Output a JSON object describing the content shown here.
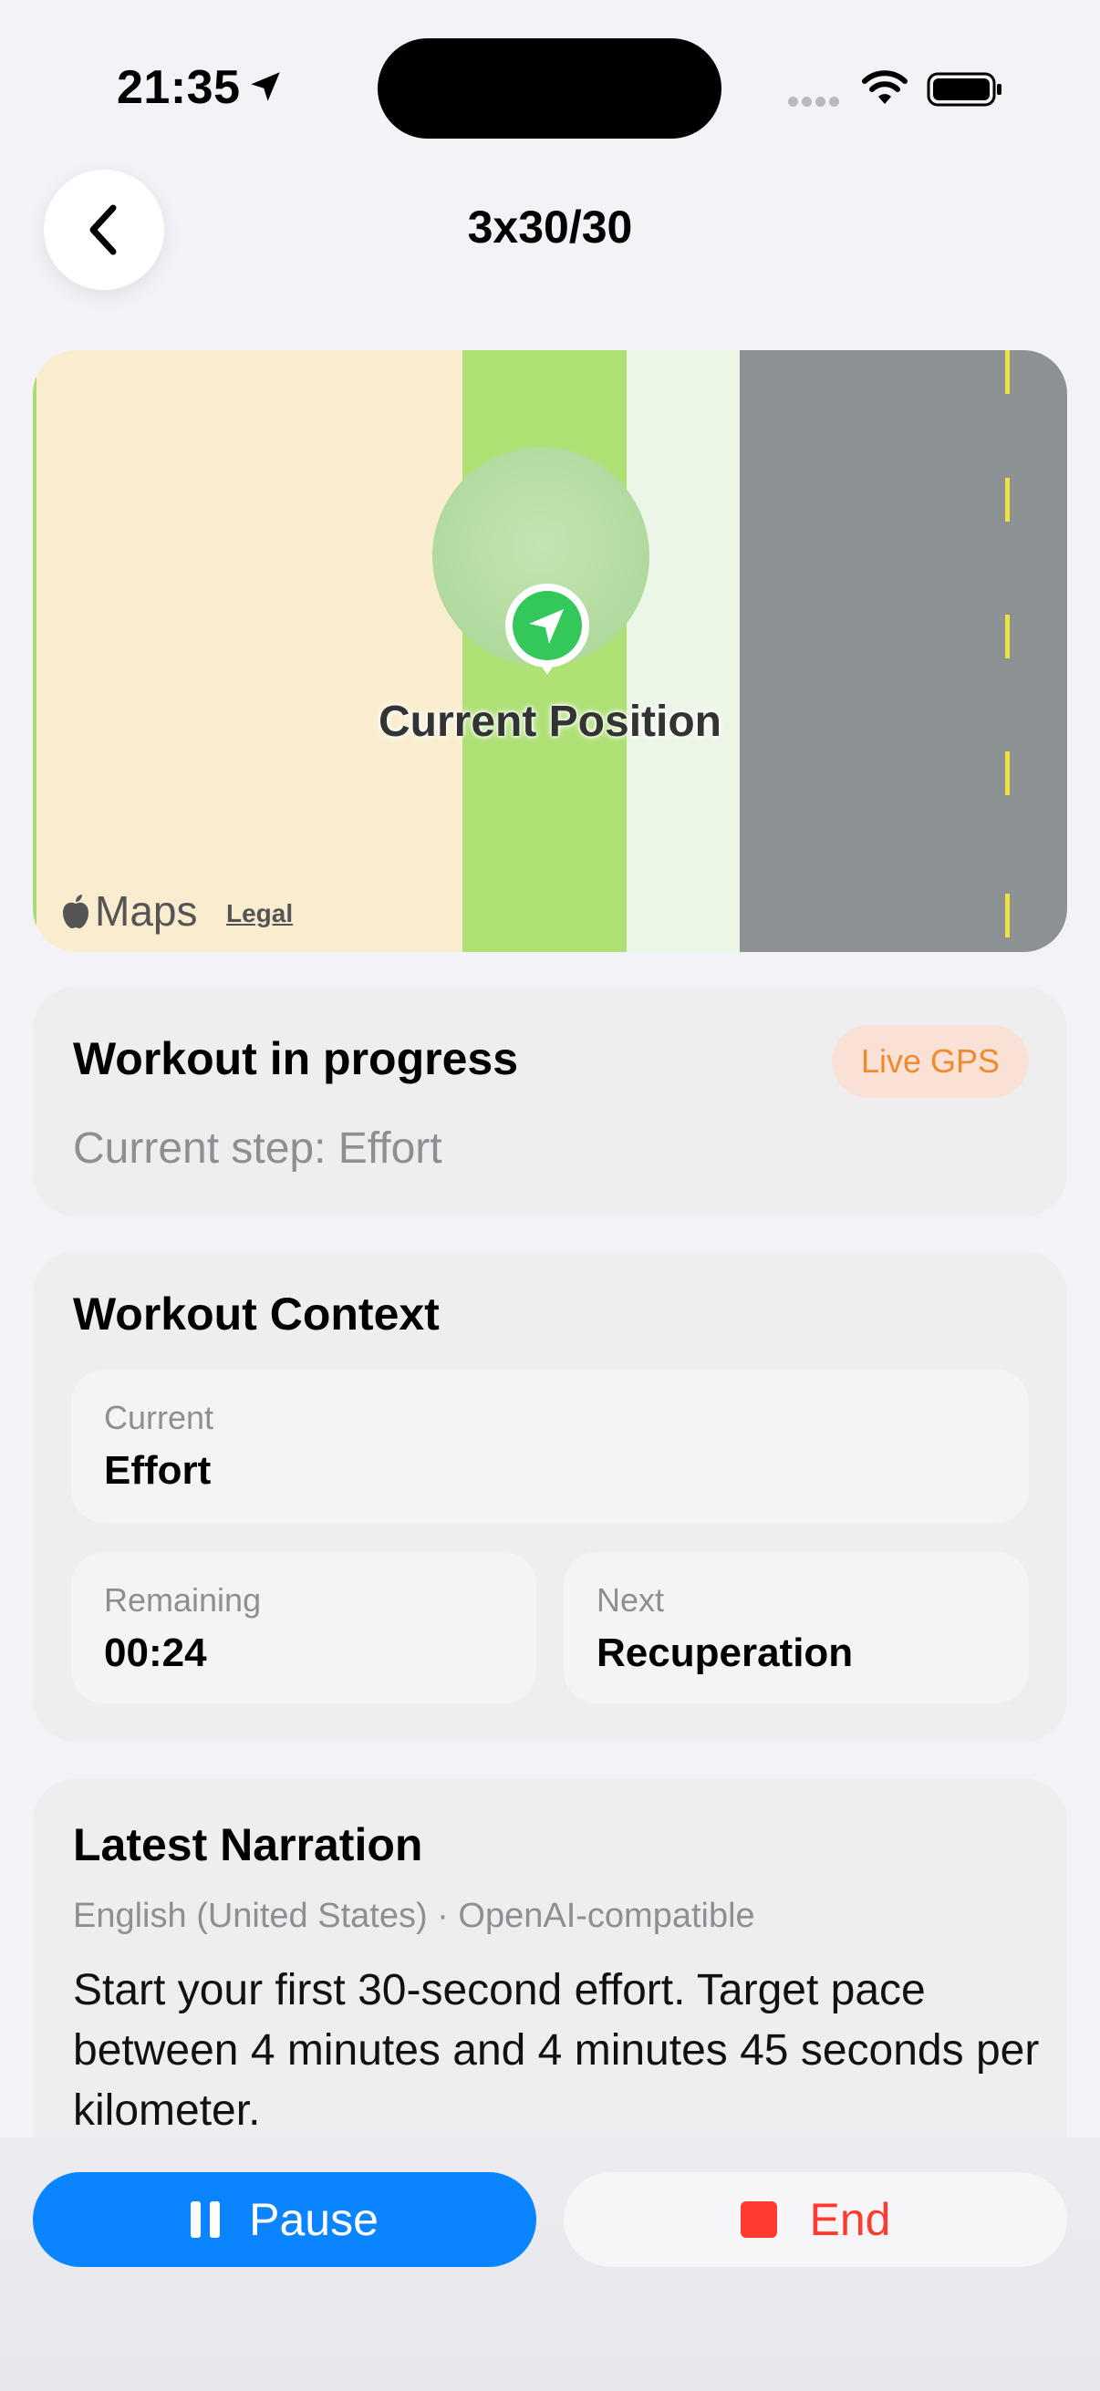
{
  "status_bar": {
    "time": "21:35"
  },
  "nav": {
    "title": "3x30/30"
  },
  "map": {
    "label": "Current Position",
    "brand": "Maps",
    "legal": "Legal"
  },
  "progress": {
    "title": "Workout in progress",
    "badge": "Live GPS",
    "step": "Current step: Effort"
  },
  "context": {
    "title": "Workout Context",
    "current_label": "Current",
    "current_value": "Effort",
    "remaining_label": "Remaining",
    "remaining_value": "00:24",
    "next_label": "Next",
    "next_value": "Recuperation"
  },
  "narration": {
    "title": "Latest Narration",
    "meta": "English (United States) · OpenAI-compatible",
    "text": "Start your first 30-second effort. Target pace between 4 minutes and 4 minutes 45 seconds per kilometer."
  },
  "actions": {
    "pause_label": "Pause",
    "end_label": "End"
  },
  "colors": {
    "accent": "#0a84ff",
    "danger": "#ff3b30",
    "badge_text": "#f08a2c",
    "location_green": "#34c759"
  }
}
